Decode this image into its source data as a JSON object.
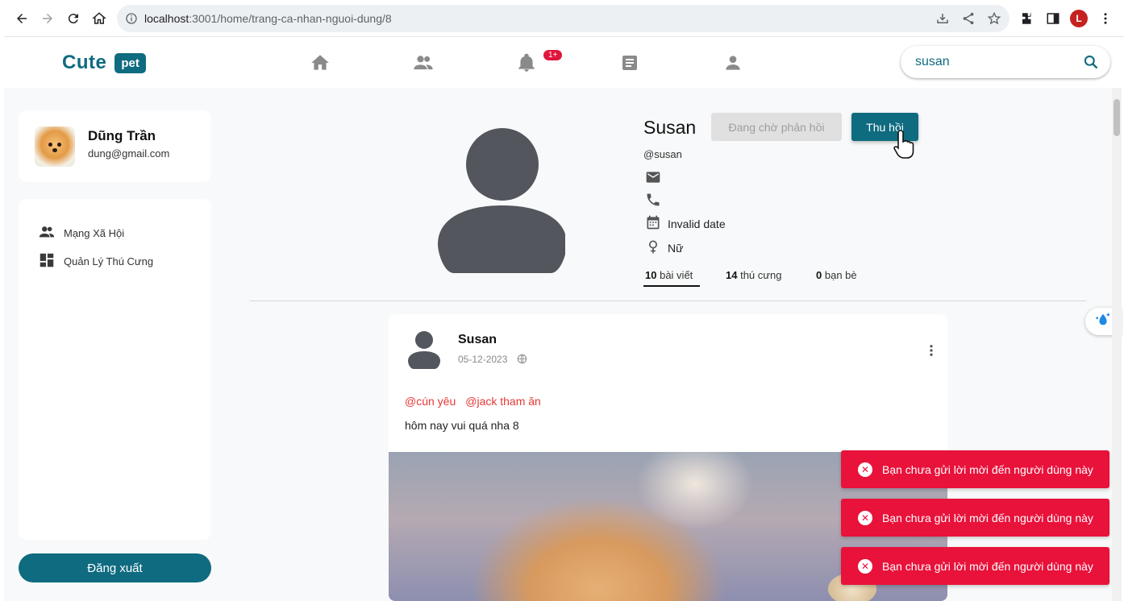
{
  "browser": {
    "url_host": "localhost",
    "url_path": ":3001/home/trang-ca-nhan-nguoi-dung/8",
    "profile_initial": "L"
  },
  "header": {
    "logo_text": "Cute",
    "logo_badge": "pet",
    "notification_badge": "1+",
    "search_value": "susan"
  },
  "sidebar": {
    "user_name": "Dũng Trần",
    "user_email": "dung@gmail.com",
    "menu": [
      {
        "label": "Mạng Xã Hội",
        "icon": "people-icon"
      },
      {
        "label": "Quản Lý Thú Cưng",
        "icon": "dashboard-icon"
      }
    ],
    "logout_label": "Đăng xuất"
  },
  "profile": {
    "name": "Susan",
    "handle": "@susan",
    "pending_label": "Đang chờ phản hồi",
    "revoke_label": "Thu hồi",
    "birthday": "Invalid date",
    "gender": "Nữ",
    "stats": {
      "posts_count": "10",
      "posts_label": "bài viết",
      "pets_count": "14",
      "pets_label": "thú cưng",
      "friends_count": "0",
      "friends_label": "bạn bè"
    }
  },
  "post": {
    "author": "Susan",
    "date": "05-12-2023",
    "tags": [
      "@cún yêu",
      "@jack tham ăn"
    ],
    "content": "hôm nay vui quá nha 8"
  },
  "toasts": [
    "Bạn chưa gửi lời mời đến người dùng này",
    "Bạn chưa gửi lời mời đến người dùng này",
    "Bạn chưa gửi lời mời đến người dùng này"
  ],
  "colors": {
    "brand": "#0f6b80",
    "error": "#e8123b",
    "tag": "#e53935"
  }
}
